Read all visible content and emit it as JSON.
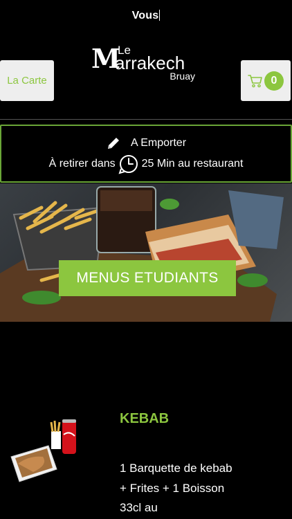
{
  "top_bar": {
    "user_label": "Vous"
  },
  "header": {
    "menu_button_label": "La Carte",
    "cart_count": "0",
    "logo": {
      "le": "Le",
      "m": "M",
      "name": "arrakech",
      "city": "Bruay"
    }
  },
  "order_info": {
    "mode": "A Emporter",
    "pickup_prefix": "À retirer dans",
    "pickup_time": "25 Min au restaurant"
  },
  "banner": {
    "button_label": "MENUS ETUDIANTS"
  },
  "product": {
    "title": "KEBAB",
    "description": "1 Barquette de kebab + Frites + 1 Boisson 33cl au"
  },
  "colors": {
    "accent": "#8cc63f",
    "border_green": "#6aa637",
    "background": "#000000",
    "button_bg": "#eeeeee"
  },
  "icons": [
    "pencil-icon",
    "clock-icon",
    "cart-icon"
  ]
}
